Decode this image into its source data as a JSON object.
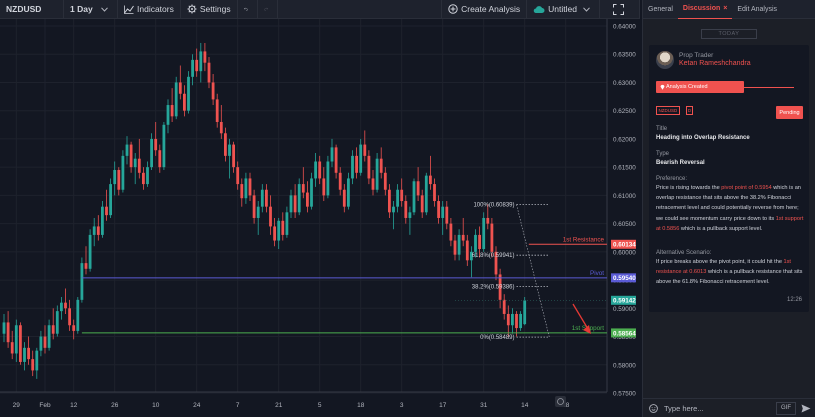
{
  "toolbar": {
    "symbol": "NZDUSD",
    "interval": "1 Day",
    "indicators_label": "Indicators",
    "settings_label": "Settings",
    "create_analysis_label": "Create Analysis",
    "layout_label": "Untitled",
    "icons": [
      "chevron-down-icon",
      "indicators-icon",
      "gear-icon",
      "undo-icon",
      "redo-icon",
      "plus-circle-icon",
      "cloud-icon",
      "expand-icon"
    ]
  },
  "panel": {
    "tabs": [
      {
        "label": "General"
      },
      {
        "label": "Discussion",
        "close": "×"
      },
      {
        "label": "Edit Analysis"
      }
    ],
    "today_label": "TODAY",
    "post": {
      "role": "Prop Trader",
      "author": "Ketan Rameshchandra",
      "status_ribbon": "Analysis Created",
      "symbol_badge": "NZDUSD",
      "interval_badge": "D",
      "status_button": "Pending",
      "title_label": "Title",
      "title": "Heading into Overlap Resistance",
      "type_label": "Type",
      "type": "Bearish Reversal",
      "preference_label": "Preference:",
      "preference": [
        {
          "t": "Price is rising towards the "
        },
        {
          "t": "pivot point of 0.5954",
          "hl": true
        },
        {
          "t": " which is an overlap resistance that sits above  the 38.2% Fibonacci retracement level and could potentially reverse from here; we could see momentum carry price down to its "
        },
        {
          "t": "1st support at 0.5856",
          "hl": true
        },
        {
          "t": " which is a pullback support level."
        }
      ],
      "alternative_label": "Alternative Scenario:",
      "alternative": [
        {
          "t": "If price breaks above the pivot point, it could hit the "
        },
        {
          "t": "1st resistance at 0.6013",
          "hl": true
        },
        {
          "t": " which is a pullback resistance that sits above the 61.8% Fibonacci retracement level."
        }
      ],
      "time": "12:26"
    },
    "chat_placeholder": "Type here...",
    "gif_label": "GIF"
  },
  "chart_data": {
    "type": "candlestick",
    "symbol": "NZDUSD",
    "interval": "1D",
    "ylim": [
      0.575,
      0.64
    ],
    "y_ticks": [
      "0.64000",
      "0.63500",
      "0.63000",
      "0.62500",
      "0.62000",
      "0.61500",
      "0.61000",
      "0.60500",
      "0.60000",
      "0.59500",
      "0.59000",
      "0.58500",
      "0.58000",
      "0.57500"
    ],
    "x_ticks": [
      {
        "label": "29",
        "bar": 3
      },
      {
        "label": "Feb",
        "bar": 10
      },
      {
        "label": "12",
        "bar": 17
      },
      {
        "label": "26",
        "bar": 27
      },
      {
        "label": "10",
        "bar": 37
      },
      {
        "label": "24",
        "bar": 47
      },
      {
        "label": "7",
        "bar": 57
      },
      {
        "label": "21",
        "bar": 67
      },
      {
        "label": "5",
        "bar": 77
      },
      {
        "label": "18",
        "bar": 87
      },
      {
        "label": "3",
        "bar": 97
      },
      {
        "label": "17",
        "bar": 107
      },
      {
        "label": "31",
        "bar": 117
      },
      {
        "label": "14",
        "bar": 127
      },
      {
        "label": "28",
        "bar": 137
      }
    ],
    "bar_count": 145,
    "candles": [
      [
        0.5855,
        0.589,
        0.584,
        0.5875
      ],
      [
        0.5875,
        0.5895,
        0.583,
        0.584
      ],
      [
        0.584,
        0.586,
        0.581,
        0.582
      ],
      [
        0.582,
        0.588,
        0.5805,
        0.587
      ],
      [
        0.587,
        0.5875,
        0.58,
        0.5805
      ],
      [
        0.5805,
        0.584,
        0.579,
        0.583
      ],
      [
        0.583,
        0.585,
        0.58,
        0.581
      ],
      [
        0.581,
        0.5825,
        0.578,
        0.579
      ],
      [
        0.579,
        0.583,
        0.5775,
        0.5825
      ],
      [
        0.5825,
        0.586,
        0.5815,
        0.585
      ],
      [
        0.585,
        0.587,
        0.582,
        0.583
      ],
      [
        0.583,
        0.588,
        0.5825,
        0.587
      ],
      [
        0.587,
        0.59,
        0.5845,
        0.5855
      ],
      [
        0.5855,
        0.5905,
        0.585,
        0.5895
      ],
      [
        0.5895,
        0.592,
        0.588,
        0.591
      ],
      [
        0.591,
        0.5935,
        0.589,
        0.59
      ],
      [
        0.59,
        0.5915,
        0.586,
        0.587
      ],
      [
        0.587,
        0.588,
        0.5845,
        0.586
      ],
      [
        0.586,
        0.592,
        0.5855,
        0.5915
      ],
      [
        0.5915,
        0.599,
        0.591,
        0.598
      ],
      [
        0.598,
        0.601,
        0.596,
        0.597
      ],
      [
        0.597,
        0.604,
        0.5965,
        0.603
      ],
      [
        0.603,
        0.606,
        0.601,
        0.6045
      ],
      [
        0.6045,
        0.6065,
        0.602,
        0.603
      ],
      [
        0.603,
        0.609,
        0.6025,
        0.608
      ],
      [
        0.608,
        0.611,
        0.6055,
        0.6065
      ],
      [
        0.6065,
        0.613,
        0.606,
        0.612
      ],
      [
        0.612,
        0.616,
        0.61,
        0.6145
      ],
      [
        0.6145,
        0.615,
        0.61,
        0.611
      ],
      [
        0.611,
        0.618,
        0.6105,
        0.617
      ],
      [
        0.617,
        0.6205,
        0.6155,
        0.619
      ],
      [
        0.619,
        0.6195,
        0.614,
        0.615
      ],
      [
        0.615,
        0.6175,
        0.612,
        0.6165
      ],
      [
        0.6165,
        0.62,
        0.613,
        0.614
      ],
      [
        0.614,
        0.615,
        0.611,
        0.612
      ],
      [
        0.612,
        0.616,
        0.6115,
        0.615
      ],
      [
        0.615,
        0.621,
        0.6145,
        0.62
      ],
      [
        0.62,
        0.623,
        0.617,
        0.618
      ],
      [
        0.618,
        0.619,
        0.614,
        0.615
      ],
      [
        0.615,
        0.623,
        0.6145,
        0.6225
      ],
      [
        0.6225,
        0.627,
        0.621,
        0.626
      ],
      [
        0.626,
        0.629,
        0.623,
        0.624
      ],
      [
        0.624,
        0.631,
        0.6235,
        0.63
      ],
      [
        0.63,
        0.633,
        0.627,
        0.628
      ],
      [
        0.628,
        0.6295,
        0.624,
        0.625
      ],
      [
        0.625,
        0.632,
        0.6245,
        0.631
      ],
      [
        0.631,
        0.635,
        0.6295,
        0.634
      ],
      [
        0.634,
        0.636,
        0.631,
        0.632
      ],
      [
        0.632,
        0.637,
        0.63,
        0.6355
      ],
      [
        0.6355,
        0.637,
        0.632,
        0.6335
      ],
      [
        0.6335,
        0.6345,
        0.629,
        0.63
      ],
      [
        0.63,
        0.6315,
        0.626,
        0.627
      ],
      [
        0.627,
        0.628,
        0.622,
        0.623
      ],
      [
        0.623,
        0.626,
        0.62,
        0.621
      ],
      [
        0.621,
        0.622,
        0.616,
        0.617
      ],
      [
        0.617,
        0.62,
        0.613,
        0.619
      ],
      [
        0.619,
        0.6195,
        0.614,
        0.615
      ],
      [
        0.615,
        0.616,
        0.611,
        0.612
      ],
      [
        0.612,
        0.613,
        0.608,
        0.6095
      ],
      [
        0.6095,
        0.614,
        0.6085,
        0.613
      ],
      [
        0.613,
        0.614,
        0.609,
        0.61
      ],
      [
        0.61,
        0.611,
        0.605,
        0.606
      ],
      [
        0.606,
        0.609,
        0.603,
        0.608
      ],
      [
        0.608,
        0.612,
        0.607,
        0.611
      ],
      [
        0.611,
        0.612,
        0.607,
        0.608
      ],
      [
        0.608,
        0.61,
        0.603,
        0.6045
      ],
      [
        0.6045,
        0.606,
        0.601,
        0.602
      ],
      [
        0.602,
        0.606,
        0.6005,
        0.6055
      ],
      [
        0.6055,
        0.607,
        0.602,
        0.603
      ],
      [
        0.603,
        0.608,
        0.6025,
        0.607
      ],
      [
        0.607,
        0.611,
        0.606,
        0.61
      ],
      [
        0.61,
        0.612,
        0.606,
        0.607
      ],
      [
        0.607,
        0.613,
        0.6065,
        0.612
      ],
      [
        0.612,
        0.615,
        0.6095,
        0.6105
      ],
      [
        0.6105,
        0.6125,
        0.607,
        0.608
      ],
      [
        0.608,
        0.614,
        0.6075,
        0.613
      ],
      [
        0.613,
        0.6175,
        0.6115,
        0.616
      ],
      [
        0.616,
        0.617,
        0.612,
        0.613
      ],
      [
        0.613,
        0.615,
        0.609,
        0.61
      ],
      [
        0.61,
        0.617,
        0.6095,
        0.616
      ],
      [
        0.616,
        0.62,
        0.615,
        0.6185
      ],
      [
        0.6185,
        0.619,
        0.613,
        0.614
      ],
      [
        0.614,
        0.615,
        0.61,
        0.611
      ],
      [
        0.611,
        0.612,
        0.607,
        0.608
      ],
      [
        0.608,
        0.614,
        0.6075,
        0.613
      ],
      [
        0.613,
        0.618,
        0.612,
        0.617
      ],
      [
        0.617,
        0.6185,
        0.613,
        0.614
      ],
      [
        0.614,
        0.62,
        0.6135,
        0.619
      ],
      [
        0.619,
        0.6215,
        0.616,
        0.617
      ],
      [
        0.617,
        0.618,
        0.612,
        0.613
      ],
      [
        0.613,
        0.6145,
        0.61,
        0.611
      ],
      [
        0.611,
        0.6175,
        0.6105,
        0.6165
      ],
      [
        0.6165,
        0.6185,
        0.613,
        0.614
      ],
      [
        0.614,
        0.615,
        0.61,
        0.611
      ],
      [
        0.611,
        0.612,
        0.606,
        0.607
      ],
      [
        0.607,
        0.609,
        0.604,
        0.608
      ],
      [
        0.608,
        0.612,
        0.607,
        0.611
      ],
      [
        0.611,
        0.613,
        0.608,
        0.609
      ],
      [
        0.609,
        0.61,
        0.605,
        0.606
      ],
      [
        0.606,
        0.608,
        0.603,
        0.607
      ],
      [
        0.607,
        0.613,
        0.6065,
        0.6125
      ],
      [
        0.6125,
        0.615,
        0.609,
        0.61
      ],
      [
        0.61,
        0.611,
        0.606,
        0.607
      ],
      [
        0.607,
        0.614,
        0.6065,
        0.6135
      ],
      [
        0.6135,
        0.617,
        0.611,
        0.612
      ],
      [
        0.612,
        0.613,
        0.608,
        0.609
      ],
      [
        0.609,
        0.61,
        0.605,
        0.606
      ],
      [
        0.606,
        0.609,
        0.603,
        0.608
      ],
      [
        0.608,
        0.609,
        0.604,
        0.605
      ],
      [
        0.605,
        0.606,
        0.601,
        0.602
      ],
      [
        0.602,
        0.603,
        0.5985,
        0.5995
      ],
      [
        0.5995,
        0.604,
        0.5985,
        0.603
      ],
      [
        0.603,
        0.606,
        0.601,
        0.602
      ],
      [
        0.602,
        0.603,
        0.5975,
        0.5985
      ],
      [
        0.5985,
        0.601,
        0.5955,
        0.6
      ],
      [
        0.6,
        0.604,
        0.599,
        0.603
      ],
      [
        0.603,
        0.6045,
        0.599,
        0.6005
      ],
      [
        0.6005,
        0.607,
        0.6,
        0.606
      ],
      [
        0.606,
        0.6084,
        0.604,
        0.605
      ],
      [
        0.605,
        0.606,
        0.599,
        0.6
      ],
      [
        0.6,
        0.601,
        0.595,
        0.596
      ],
      [
        0.596,
        0.597,
        0.59,
        0.5915
      ],
      [
        0.5915,
        0.5925,
        0.588,
        0.589
      ],
      [
        0.589,
        0.5905,
        0.5849,
        0.587
      ],
      [
        0.587,
        0.59,
        0.5855,
        0.589
      ],
      [
        0.589,
        0.5895,
        0.585,
        0.5865
      ],
      [
        0.5865,
        0.5895,
        0.586,
        0.589
      ],
      [
        0.5872,
        0.592,
        0.587,
        0.5914
      ]
    ],
    "levels": {
      "pivot": {
        "label": "Pivot",
        "value": "0.59540",
        "price": 0.5954
      },
      "resistance": {
        "label": "1st Resistance",
        "value": "0.60134",
        "price": 0.60134
      },
      "support": {
        "label": "1st Support",
        "value": "0.58564",
        "price": 0.58564
      },
      "last": {
        "value": "0.59142",
        "price": 0.59142
      }
    },
    "fib": [
      {
        "label": "100%(0.60839)",
        "price": 0.60839
      },
      {
        "label": "61.8%(0.59941)",
        "price": 0.59941
      },
      {
        "label": "38.2%(0.59386)",
        "price": 0.59386
      },
      {
        "label": "0%(0.58489)",
        "price": 0.58489
      }
    ],
    "colors": {
      "bg": "#131722",
      "grid": "#1e222d",
      "up": "#26a69a",
      "down": "#ef5350",
      "pivot": "#5b5bd6",
      "resistance": "#ef5350",
      "support": "#4caf50",
      "last": "#26a69a",
      "fib": "#b2b5be",
      "arrow": "#e53935"
    }
  }
}
